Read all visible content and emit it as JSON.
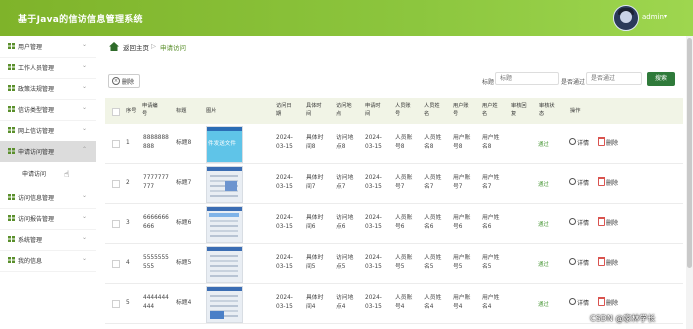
{
  "header": {
    "title": "基于Java的信访信息管理系统",
    "admin_name": "admin"
  },
  "sidebar": {
    "items": [
      {
        "label": "用户管理",
        "icon": "grid-icon",
        "color": "#5a8f2b"
      },
      {
        "label": "工作人员管理",
        "icon": "grid-icon",
        "color": "#5a8f2b"
      },
      {
        "label": "政策法规管理",
        "icon": "grid-icon",
        "color": "#5a8f2b"
      },
      {
        "label": "信访类型管理",
        "icon": "grid-icon",
        "color": "#5a8f2b"
      },
      {
        "label": "网上信访管理",
        "icon": "grid-icon",
        "color": "#5a8f2b"
      },
      {
        "label": "申请访问管理",
        "icon": "grid-icon",
        "color": "#5a8f2b",
        "active": true
      },
      {
        "label": "申请访问",
        "sub": true
      },
      {
        "label": "访问信息管理",
        "icon": "grid-icon",
        "color": "#5a8f2b"
      },
      {
        "label": "访问报告管理",
        "icon": "grid-icon",
        "color": "#5a8f2b"
      },
      {
        "label": "系统管理",
        "icon": "grid-icon",
        "color": "#5a8f2b"
      },
      {
        "label": "我的信息",
        "icon": "grid-icon",
        "color": "#5a8f2b"
      }
    ]
  },
  "breadcrumb": {
    "home": "返回主页",
    "current": "申请访问"
  },
  "toolbar": {
    "delete_label": "删除"
  },
  "filters": {
    "label1": "标题",
    "placeholder1": "标题",
    "label2": "是否通过",
    "placeholder2": "是否通过",
    "search_label": "搜索"
  },
  "table": {
    "headers": [
      "序号",
      "申请编号",
      "标题",
      "图片",
      "访问日期",
      "具体时间",
      "访问地点",
      "申请时间",
      "人员账号",
      "人员姓名",
      "用户账号",
      "用户姓名",
      "审核回复",
      "审核状态",
      "操作"
    ],
    "rows": [
      {
        "no": "1",
        "code": "8888888888",
        "title": "标题8",
        "img_text": "件发送文件",
        "date": "2024-03-15",
        "time": "具体时间8",
        "place": "访问地点8",
        "apply": "2024-03-15",
        "staff_acc": "人员账号8",
        "staff_name": "人员姓名8",
        "user_acc": "用户账号8",
        "user_name": "用户姓名8",
        "reply": "",
        "status": "通过"
      },
      {
        "no": "2",
        "code": "7777777777",
        "title": "标题7",
        "img_text": "",
        "date": "2024-03-15",
        "time": "具体时间7",
        "place": "访问地点7",
        "apply": "2024-03-15",
        "staff_acc": "人员账号7",
        "staff_name": "人员姓名7",
        "user_acc": "用户账号7",
        "user_name": "用户姓名7",
        "reply": "",
        "status": "通过"
      },
      {
        "no": "3",
        "code": "6666666666",
        "title": "标题6",
        "img_text": "",
        "date": "2024-03-15",
        "time": "具体时间6",
        "place": "访问地点6",
        "apply": "2024-03-15",
        "staff_acc": "人员账号6",
        "staff_name": "人员姓名6",
        "user_acc": "用户账号6",
        "user_name": "用户姓名6",
        "reply": "",
        "status": "通过"
      },
      {
        "no": "4",
        "code": "5555555555",
        "title": "标题5",
        "img_text": "",
        "date": "2024-03-15",
        "time": "具体时间5",
        "place": "访问地点5",
        "apply": "2024-03-15",
        "staff_acc": "人员账号5",
        "staff_name": "人员姓名5",
        "user_acc": "用户账号5",
        "user_name": "用户姓名5",
        "reply": "",
        "status": "通过"
      },
      {
        "no": "5",
        "code": "4444444444",
        "title": "标题4",
        "img_text": "",
        "date": "2024-03-15",
        "time": "具体时间4",
        "place": "访问地点4",
        "apply": "2024-03-15",
        "staff_acc": "人员账号4",
        "staff_name": "人员姓名4",
        "user_acc": "用户账号4",
        "user_name": "用户姓名4",
        "reply": "",
        "status": "通过"
      }
    ],
    "action_detail": "详情",
    "action_delete": "删除"
  },
  "watermark": "CSDN @家林学长"
}
